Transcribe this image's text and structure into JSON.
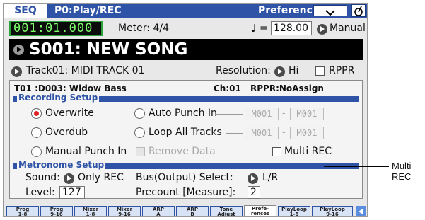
{
  "titlebar": {
    "mode": "SEQ",
    "page": "P0:Play/REC",
    "tab": "Preferences"
  },
  "location": {
    "value": "001:01.000",
    "meter_label": "Meter:  4/4",
    "tempo_note": "♩",
    "tempo_eq": "=",
    "tempo": "128.00",
    "tempo_mode": "Manual"
  },
  "song": {
    "name": "S001: NEW SONG"
  },
  "track": {
    "label": "Track01: MIDI TRACK 01",
    "resolution_label": "Resolution:",
    "resolution_value": "Hi",
    "rppr_label": "RPPR"
  },
  "info": {
    "track": "T01 :D003: Widow Bass",
    "channel": "Ch:01",
    "rppr": "RPPR:NoAssign"
  },
  "recording": {
    "title": "Recording Setup",
    "overwrite": "Overwrite",
    "overdub": "Overdub",
    "manual_punch": "Manual Punch In",
    "auto_punch": "Auto Punch In",
    "loop_all": "Loop All Tracks",
    "remove_data": "Remove Data",
    "multi_rec": "Multi REC",
    "range_start": "M001",
    "range_end": "M001",
    "range_sep": "-",
    "selected": "Overwrite"
  },
  "metronome": {
    "title": "Metronome Setup",
    "sound_label": "Sound:",
    "sound_value": "Only REC",
    "bus_label": "Bus(Output) Select:",
    "bus_value": "L/R",
    "level_label": "Level:",
    "level_value": "127",
    "precount_label": "Precount [Measure]:",
    "precount_value": "2"
  },
  "tabs": [
    {
      "l1": "Prog",
      "l2": "1-8"
    },
    {
      "l1": "Prog",
      "l2": "9-16"
    },
    {
      "l1": "Mixer",
      "l2": "1-8"
    },
    {
      "l1": "Mixer",
      "l2": "9-16"
    },
    {
      "l1": "ARP",
      "l2": "A"
    },
    {
      "l1": "ARP",
      "l2": "B"
    },
    {
      "l1": "Tone",
      "l2": "Adjust"
    },
    {
      "l1": "Prefe-",
      "l2": "rences"
    },
    {
      "l1": "PlayLoop",
      "l2": "1-8"
    },
    {
      "l1": "PlayLoop",
      "l2": "9-16"
    }
  ],
  "callout": "Multi REC",
  "colors": {
    "accent": "#2f53a6",
    "radio_selected": "#dd2222",
    "location_text": "#7cff6a"
  }
}
